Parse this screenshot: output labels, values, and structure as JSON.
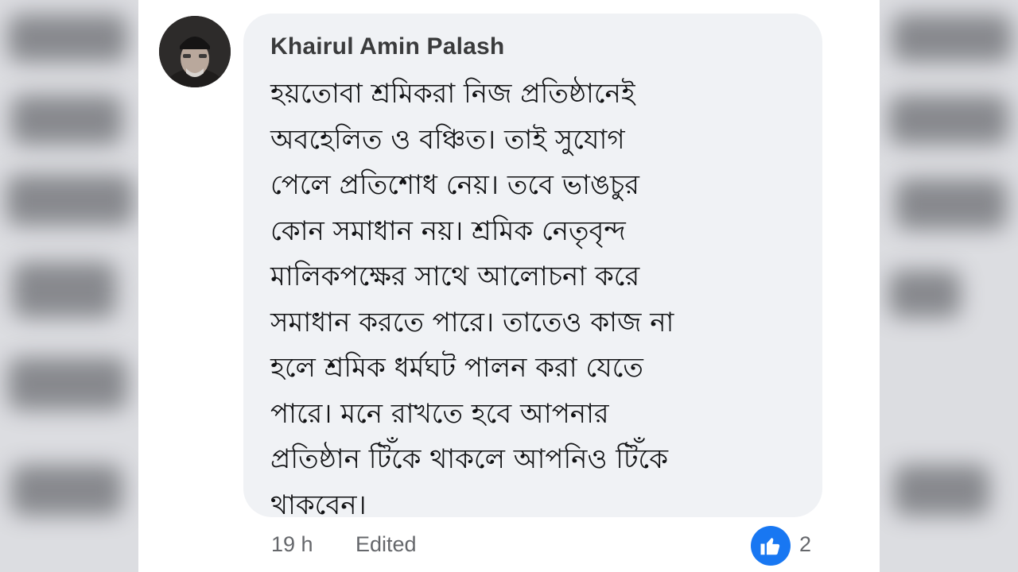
{
  "comment": {
    "author": "Khairul Amin Palash",
    "lines": [
      "হয়তোবা শ্রমিকরা নিজ প্রতিষ্ঠানেই",
      "অবহেলিত ও বঞ্চিত। তাই সুযোগ",
      "পেলে প্রতিশোধ নেয়। তবে ভাঙচুর",
      "কোন সমাধান নয়। শ্রমিক নেতৃবৃন্দ",
      "মালিকপক্ষের সাথে আলোচনা করে",
      "সমাধান করতে পারে। তাতেও কাজ না",
      "হলে শ্রমিক ধর্মঘট পালন করা যেতে",
      "পারে। মনে রাখতে হবে আপনার",
      "প্রতিষ্ঠান টিঁকে থাকলে আপনিও টিঁকে",
      "থাকবেন।"
    ],
    "time": "19 h",
    "edited_label": "Edited",
    "reaction_count": "2",
    "reaction_icon": "thumbs-up-icon"
  },
  "colors": {
    "bubble": "#f0f2f5",
    "like_blue": "#1877f2",
    "meta_text": "#65676b"
  }
}
